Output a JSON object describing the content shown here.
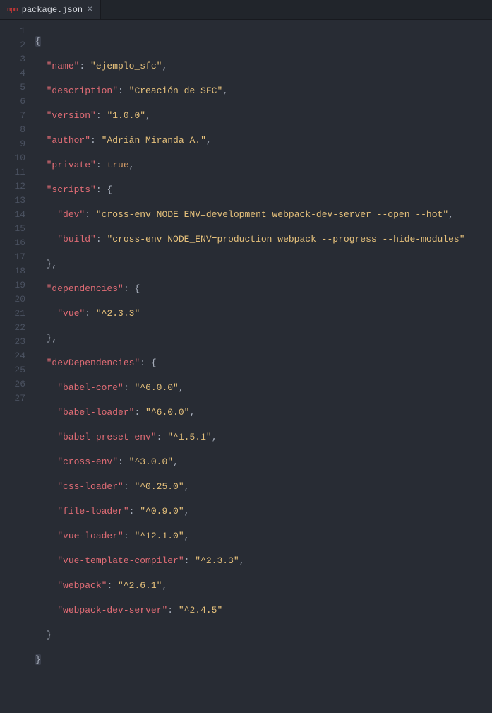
{
  "tab": {
    "filename": "package.json",
    "icon_label": "npm"
  },
  "lines": {
    "l1": {
      "open": "{"
    },
    "l2": {
      "key": "\"name\"",
      "colon": ": ",
      "val": "\"ejemplo_sfc\"",
      "comma": ","
    },
    "l3": {
      "key": "\"description\"",
      "colon": ": ",
      "val": "\"Creación de SFC\"",
      "comma": ","
    },
    "l4": {
      "key": "\"version\"",
      "colon": ": ",
      "val": "\"1.0.0\"",
      "comma": ","
    },
    "l5": {
      "key": "\"author\"",
      "colon": ": ",
      "val": "\"Adrián Miranda A.\"",
      "comma": ","
    },
    "l6": {
      "key": "\"private\"",
      "colon": ": ",
      "val": "true",
      "comma": ","
    },
    "l7": {
      "key": "\"scripts\"",
      "colon": ": ",
      "open": "{"
    },
    "l8": {
      "key": "\"dev\"",
      "colon": ": ",
      "val": "\"cross-env NODE_ENV=development webpack-dev-server --open --hot\"",
      "comma": ","
    },
    "l9": {
      "key": "\"build\"",
      "colon": ": ",
      "val": "\"cross-env NODE_ENV=production webpack --progress --hide-modules\""
    },
    "l10": {
      "close": "}",
      "comma": ","
    },
    "l11": {
      "key": "\"dependencies\"",
      "colon": ": ",
      "open": "{"
    },
    "l12": {
      "key": "\"vue\"",
      "colon": ": ",
      "val": "\"^2.3.3\""
    },
    "l13": {
      "close": "}",
      "comma": ","
    },
    "l14": {
      "key": "\"devDependencies\"",
      "colon": ": ",
      "open": "{"
    },
    "l15": {
      "key": "\"babel-core\"",
      "colon": ": ",
      "val": "\"^6.0.0\"",
      "comma": ","
    },
    "l16": {
      "key": "\"babel-loader\"",
      "colon": ": ",
      "val": "\"^6.0.0\"",
      "comma": ","
    },
    "l17": {
      "key": "\"babel-preset-env\"",
      "colon": ": ",
      "val": "\"^1.5.1\"",
      "comma": ","
    },
    "l18": {
      "key": "\"cross-env\"",
      "colon": ": ",
      "val": "\"^3.0.0\"",
      "comma": ","
    },
    "l19": {
      "key": "\"css-loader\"",
      "colon": ": ",
      "val": "\"^0.25.0\"",
      "comma": ","
    },
    "l20": {
      "key": "\"file-loader\"",
      "colon": ": ",
      "val": "\"^0.9.0\"",
      "comma": ","
    },
    "l21": {
      "key": "\"vue-loader\"",
      "colon": ": ",
      "val": "\"^12.1.0\"",
      "comma": ","
    },
    "l22": {
      "key": "\"vue-template-compiler\"",
      "colon": ": ",
      "val": "\"^2.3.3\"",
      "comma": ","
    },
    "l23": {
      "key": "\"webpack\"",
      "colon": ": ",
      "val": "\"^2.6.1\"",
      "comma": ","
    },
    "l24": {
      "key": "\"webpack-dev-server\"",
      "colon": ": ",
      "val": "\"^2.4.5\""
    },
    "l25": {
      "close": "}"
    },
    "l26": {
      "close": "}"
    }
  },
  "line_numbers": [
    "1",
    "2",
    "3",
    "4",
    "5",
    "6",
    "7",
    "8",
    "9",
    "10",
    "11",
    "12",
    "13",
    "14",
    "15",
    "16",
    "17",
    "18",
    "19",
    "20",
    "21",
    "22",
    "23",
    "24",
    "25",
    "26",
    "27"
  ]
}
